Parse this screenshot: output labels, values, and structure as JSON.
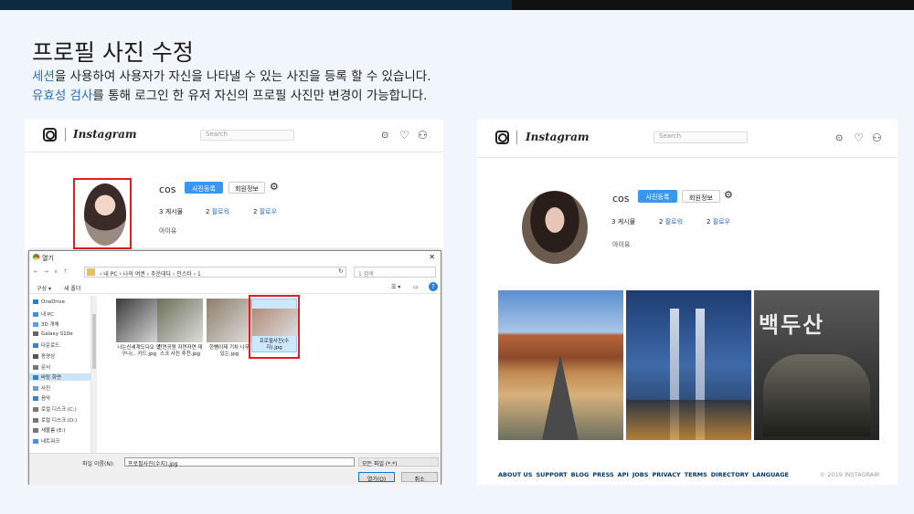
{
  "slide": {
    "title": "프로필 사진 수정",
    "desc1_hl": "세션",
    "desc1_rest": "을 사용하여 사용자가 자신을 나타낼 수 있는 사진을 등록 할 수 있습니다.",
    "desc2_hl": "유효성 검사",
    "desc2_rest": "를 통해 로그인 한 유저 자신의 프로필 사진만 변경이 가능합니다."
  },
  "colors": {
    "accent": "#3897f0",
    "highlight": "#2e6fb8",
    "selection_red": "#e02020"
  },
  "left": {
    "logo": "Instagram",
    "search_placeholder": "Search",
    "username": "cos",
    "upload_button": "사진등록",
    "profile_button": "회원정보",
    "posts_count": "3",
    "posts_label": "게시물",
    "followers_count": "2",
    "followers_label": "팔로워",
    "following_count": "2",
    "following_label": "팔로우",
    "bio": "아이유"
  },
  "dialog": {
    "title": "열기",
    "close": "✕",
    "nav": "← → ∨ ↑",
    "path": "› 내 PC › 나의 여권 › 추운데다 › 인스타 › 1",
    "search_placeholder": "1 검색",
    "organize": "구성 ▾",
    "new_folder": "새 폴더",
    "sidebar": [
      {
        "label": "OneDrive",
        "color": "#2f7bd0"
      },
      {
        "label": "내 PC",
        "color": "#4a90d9"
      },
      {
        "label": "3D 개체",
        "color": "#5aa0e0"
      },
      {
        "label": "Galaxy S10e",
        "color": "#666666"
      },
      {
        "label": "다운로드",
        "color": "#3b7fc4"
      },
      {
        "label": "동영상",
        "color": "#555555"
      },
      {
        "label": "문서",
        "color": "#777777"
      },
      {
        "label": "바탕 화면",
        "color": "#3b7fc4",
        "selected": true
      },
      {
        "label": "사진",
        "color": "#6a9fd4"
      },
      {
        "label": "음악",
        "color": "#3b7fc4"
      },
      {
        "label": "로컬 디스크 (C:)",
        "color": "#777777"
      },
      {
        "label": "로컬 디스크 (D:)",
        "color": "#777777"
      },
      {
        "label": "새볼륨 (E:)",
        "color": "#777777"
      },
      {
        "label": "네트워크",
        "color": "#4a90d9"
      }
    ],
    "files": [
      {
        "name": "나는신세계도다오 었구나(.. 카드.jpg",
        "thumb": "#3a3a3a"
      },
      {
        "name": "천연공원 자연자연 데스크 사진 추천.jpg",
        "thumb": "#6b6f58"
      },
      {
        "name": "한뼘이제 기차 나무 있는.jpg",
        "thumb": "#8e7f6a"
      },
      {
        "name": "프로필사진(수지).jpg",
        "thumb": "#b08a78",
        "selected": true
      }
    ],
    "filename_label": "파일 이름(N):",
    "filename_value": "프로필사진(수지).jpg",
    "filter": "모든 파일 (*.*)",
    "open_button": "열기(O)",
    "cancel_button": "취소"
  },
  "right": {
    "logo": "Instagram",
    "search_placeholder": "Search",
    "username": "cos",
    "upload_button": "사진등록",
    "profile_button": "회원정보",
    "posts_count": "3",
    "posts_label": "게시물",
    "followers_count": "2",
    "followers_label": "팔로워",
    "following_count": "2",
    "following_label": "팔로우",
    "bio": "아이유",
    "poster_text": "백두산",
    "footer_links": [
      "ABOUT US",
      "SUPPORT",
      "BLOG",
      "PRESS",
      "API",
      "JOBS",
      "PRIVACY",
      "TERMS",
      "DIRECTORY",
      "LANGUAGE"
    ],
    "copyright": "© 2019 INSTAGRAM"
  },
  "icons": [
    "camera-icon",
    "compass-icon",
    "heart-icon",
    "person-icon",
    "gear-icon",
    "refresh-icon",
    "help-icon"
  ]
}
